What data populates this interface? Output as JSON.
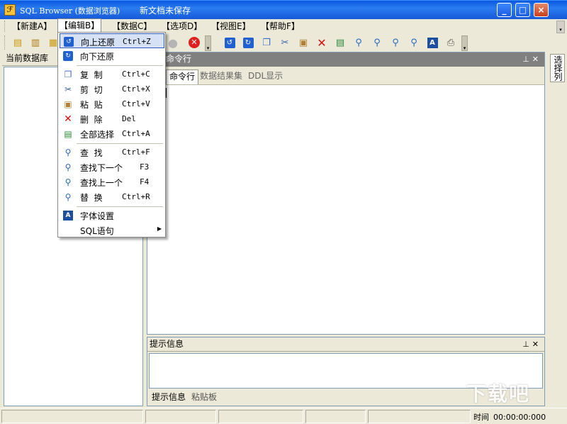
{
  "window": {
    "title": "SQL Browser (数据浏览器)",
    "document_name": "新文档未保存",
    "controls": {
      "minimize": "_",
      "maximize": "□",
      "close": "×"
    }
  },
  "menubar": {
    "items": [
      "【新建A】",
      "【编辑B】",
      "【数据C】",
      "【选项D】",
      "【视图E】",
      "【帮助F】"
    ],
    "active_index": 1
  },
  "toolbar": {
    "buttons": [
      "new-icon",
      "open-icon",
      "save-icon",
      "run-icon",
      "stop-icon",
      "undo-icon",
      "redo-icon",
      "copy-icon",
      "cut-icon",
      "paste-icon",
      "delete-icon",
      "select-all-icon",
      "find-icon",
      "find-next-icon",
      "find-prev-icon",
      "replace-icon",
      "font-icon",
      "print-icon"
    ]
  },
  "edit_menu": {
    "items": [
      {
        "label": "向上还原",
        "shortcut": "Ctrl+Z",
        "icon": "undo-icon",
        "highlight": true
      },
      {
        "label": "向下还原",
        "shortcut": "",
        "icon": "redo-icon"
      },
      {
        "label": "复  制",
        "shortcut": "Ctrl+C",
        "icon": "copy-icon"
      },
      {
        "label": "剪  切",
        "shortcut": "Ctrl+X",
        "icon": "cut-icon"
      },
      {
        "label": "粘  贴",
        "shortcut": "Ctrl+V",
        "icon": "paste-icon"
      },
      {
        "label": "删  除",
        "shortcut": "Del",
        "icon": "delete-icon"
      },
      {
        "label": "全部选择",
        "shortcut": "Ctrl+A",
        "icon": "select-all-icon"
      },
      {
        "label": "查  找",
        "shortcut": "Ctrl+F",
        "icon": "find-icon"
      },
      {
        "label": "查找下一个",
        "shortcut": "F3",
        "icon": "find-next-icon"
      },
      {
        "label": "查找上一个",
        "shortcut": "F4",
        "icon": "find-prev-icon"
      },
      {
        "label": "替  换",
        "shortcut": "Ctrl+R",
        "icon": "replace-icon"
      },
      {
        "label": "字体设置",
        "shortcut": "",
        "icon": "font-icon"
      },
      {
        "label": "SQL语句",
        "shortcut": "",
        "icon": "",
        "submenu": true
      }
    ]
  },
  "left_panel": {
    "title": "当前数据库"
  },
  "command_panel": {
    "title": "命令行",
    "tabs": [
      "命令行",
      "数据结果集",
      "DDL显示"
    ],
    "active_tab": 0
  },
  "hint_panel": {
    "title": "提示信息",
    "tabs": [
      "提示信息",
      "粘贴板"
    ],
    "active_tab": 0
  },
  "right_strip": {
    "tab_label": "选择列"
  },
  "status": {
    "time_label": "时间",
    "time_value": "00:00:00:000"
  },
  "watermark": "下载吧",
  "colors": {
    "title_blue": "#1758d8",
    "menu_highlight": "#d6e1f5",
    "panel_header": "#808080"
  }
}
